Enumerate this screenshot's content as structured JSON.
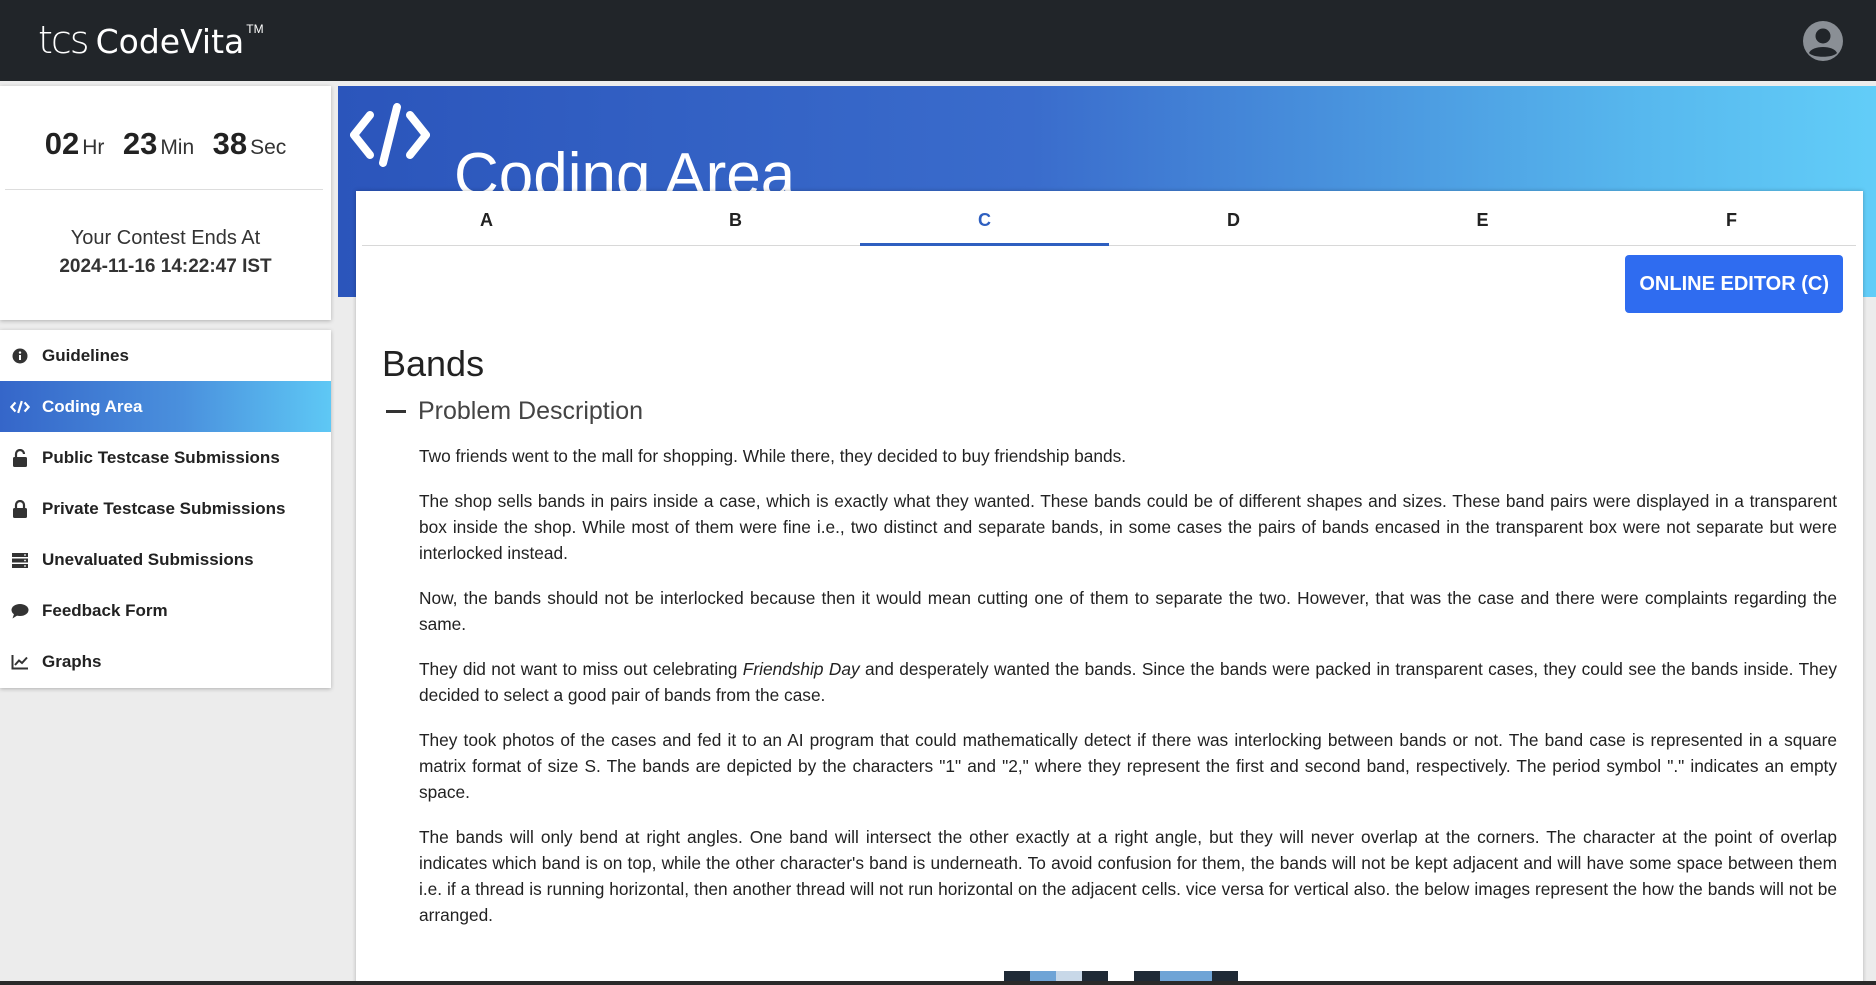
{
  "brand": {
    "tcs": "tcs",
    "name": "CodeVita",
    "tm": "TM"
  },
  "timer": {
    "hours": "02",
    "hours_unit": "Hr",
    "minutes": "23",
    "minutes_unit": "Min",
    "seconds": "38",
    "seconds_unit": "Sec",
    "ends_label": "Your Contest Ends At",
    "ends_time": "2024-11-16 14:22:47 IST"
  },
  "nav": {
    "items": [
      {
        "label": "Guidelines",
        "icon": "info-circle-icon"
      },
      {
        "label": "Coding Area",
        "icon": "code-icon"
      },
      {
        "label": "Public Testcase Submissions",
        "icon": "unlock-icon"
      },
      {
        "label": "Private Testcase Submissions",
        "icon": "lock-icon"
      },
      {
        "label": "Unevaluated Submissions",
        "icon": "server-icon"
      },
      {
        "label": "Feedback Form",
        "icon": "comment-icon"
      },
      {
        "label": "Graphs",
        "icon": "chart-line-icon"
      }
    ],
    "active": "Coding Area"
  },
  "header": {
    "title": "Coding Area",
    "icon": "code-icon"
  },
  "tabs": [
    "A",
    "B",
    "C",
    "D",
    "E",
    "F"
  ],
  "active_tab": "C",
  "editor_button": "ONLINE EDITOR (C)",
  "problem": {
    "title": "Bands",
    "section": "Problem Description",
    "p1": "Two friends went to the mall for shopping. While there, they decided to buy friendship bands.",
    "p2": "The shop sells bands in pairs inside a case, which is exactly what they wanted. These bands could be of different shapes and sizes. These band pairs were displayed in a transparent box inside the shop. While most of them were fine i.e., two distinct and separate bands, in some cases the pairs of bands encased in the transparent box were not separate but were interlocked instead.",
    "p3": "Now, the bands should not be interlocked because then it would mean cutting one of them to separate the two. However, that was the case and there were complaints regarding the same.",
    "p4_before": "They did not want to miss out celebrating ",
    "p4_em": "Friendship Day",
    "p4_after": " and desperately wanted the bands. Since the bands were packed in transparent cases, they could see the bands inside. They decided to select a good pair of bands from the case.",
    "p5": "They took photos of the cases and fed it to an AI program that could mathematically detect if there was interlocking between bands or not. The band case is represented in a square matrix format of size S. The bands are depicted by the characters \"1\" and \"2,\" where they represent the first and second band, respectively. The period symbol \".\" indicates an empty space.",
    "p6": "The bands will only bend at right angles. One band will intersect the other exactly at a right angle, but they will never overlap at the corners. The character at the point of overlap indicates which band is on top, while the other character's band is underneath. To avoid confusion for them, the bands will not be kept adjacent and will have some space between them i.e. if a thread is running horizontal, then another thread will not run horizontal on the adjacent cells. vice versa for vertical also. the below images represent the how the bands will not be arranged."
  },
  "colors": {
    "topbar": "#212529",
    "accent": "#2e5fc0",
    "button": "#2f6cf0"
  }
}
